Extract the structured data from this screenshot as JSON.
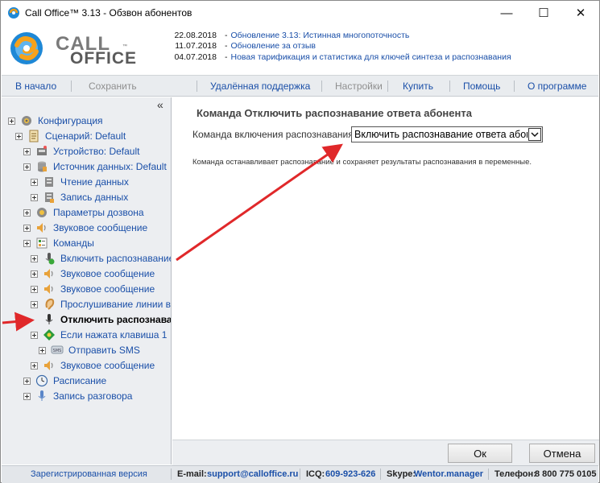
{
  "window": {
    "title": "Call Office™ 3.13 - Обзвон абонентов",
    "min_glyph": "—",
    "max_glyph": "☐",
    "close_glyph": "✕"
  },
  "logo": {
    "line1": "CALL",
    "line2": "OFFICE",
    "tm": "™"
  },
  "news": [
    {
      "date": "22.08.2018",
      "dash": "-",
      "text": "Обновление 3.13: Истинная многопоточность"
    },
    {
      "date": "11.07.2018",
      "dash": "-",
      "text": "Обновление за отзыв"
    },
    {
      "date": "04.07.2018",
      "dash": "-",
      "text": "Новая тарификация и статистика для ключей синтеза и распознавания"
    }
  ],
  "nav": {
    "home": "В начало",
    "save": "Сохранить",
    "remote_support": "Удалённая поддержка",
    "settings": "Настройки",
    "buy": "Купить",
    "help": "Помощь",
    "about": "О программе"
  },
  "tree": {
    "collapse_glyph": "«",
    "items": [
      {
        "label": "Конфигурация",
        "icon": "gear-icon"
      },
      {
        "label": "Сценарий: Default",
        "icon": "script-icon"
      },
      {
        "label": "Устройство: Default",
        "icon": "device-icon"
      },
      {
        "label": "Источник данных: Default",
        "icon": "database-icon"
      },
      {
        "label": "Чтение данных",
        "icon": "read-data-icon"
      },
      {
        "label": "Запись данных",
        "icon": "write-data-icon"
      },
      {
        "label": "Параметры дозвона",
        "icon": "dial-settings-icon"
      },
      {
        "label": "Звуковое сообщение",
        "icon": "speaker-icon"
      },
      {
        "label": "Команды",
        "icon": "commands-icon"
      },
      {
        "label": "Включить распознавание",
        "icon": "recognition-on-icon"
      },
      {
        "label": "Звуковое сообщение",
        "icon": "speaker-icon"
      },
      {
        "label": "Звуковое сообщение",
        "icon": "speaker-icon"
      },
      {
        "label": "Прослушивание линии в",
        "icon": "ear-icon"
      },
      {
        "label": "Отключить распознава",
        "icon": "recognition-off-icon"
      },
      {
        "label": "Если нажата клавиша 1",
        "icon": "key-condition-icon"
      },
      {
        "label": "Отправить SMS",
        "icon": "sms-icon"
      },
      {
        "label": "Звуковое сообщение",
        "icon": "speaker-icon"
      },
      {
        "label": "Расписание",
        "icon": "schedule-icon"
      },
      {
        "label": "Запись разговора",
        "icon": "microphone-icon"
      }
    ]
  },
  "content": {
    "heading": "Команда Отключить распознавание ответа абонента",
    "field_label": "Команда включения распознавания:",
    "selected_value": "Включить распознавание ответа абонента",
    "description": "Команда останавливает распознавание и сохраняет результаты распознавания в переменные."
  },
  "buttons": {
    "ok": "Ок",
    "cancel": "Отмена"
  },
  "status": {
    "registered": "Зарегистрированная версия",
    "email_label": "E-mail:",
    "email": "support@calloffice.ru",
    "icq_label": "ICQ:",
    "icq": "609-923-626",
    "skype_label": "Skype:",
    "skype": "Wentor.manager",
    "phone_label": "Телефон:",
    "phone": "8 800 775 0105"
  },
  "colors": {
    "link": "#1a4fa8",
    "panel": "#eceef1",
    "arrow": "#e0282a"
  }
}
